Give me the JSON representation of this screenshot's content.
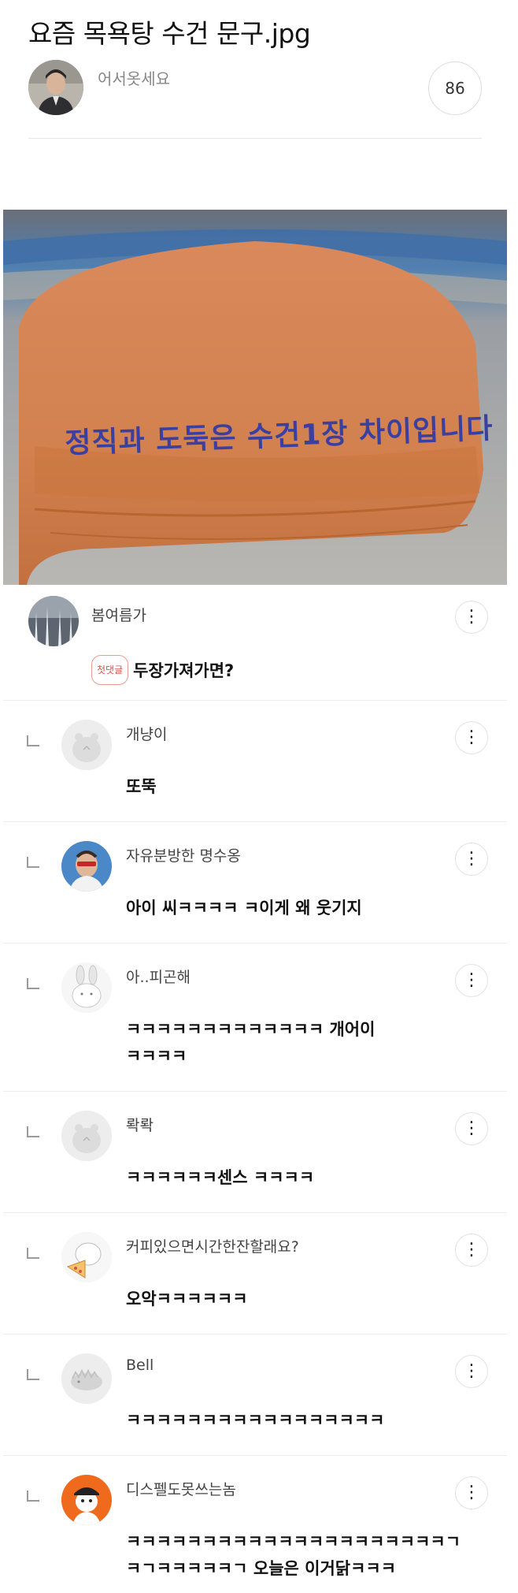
{
  "post": {
    "title": "요즘 목욕탕 수건 문구.jpg",
    "author": "어서옷세요",
    "comment_count": "86",
    "image_text": "정직과 도둑은 수건1장 차이입니다"
  },
  "icons": {
    "more": "more-vertical-icon",
    "reply": "reply-arrow-icon"
  },
  "comments": [
    {
      "name": "봄여름가",
      "badge": "첫댓글",
      "body": "두장가져가면?"
    },
    {
      "name": "개냥이",
      "body": "또뚝"
    },
    {
      "name": "자유분방한 명수옹",
      "body": "아이 씨ㅋㅋㅋㅋ ㅋ이게 왜 웃기지"
    },
    {
      "name": "아..피곤해",
      "body_line1": "ㅋㅋㅋㅋㅋㅋㅋㅋㅋㅋㅋㅋㅋ 개어이",
      "body_line2": "ㅋㅋㅋㅋ"
    },
    {
      "name": "롹롹",
      "body": "ㅋㅋㅋㅋㅋㅋ센스 ㅋㅋㅋㅋ"
    },
    {
      "name": "커피있으면시간한잔할래요?",
      "body": "오악ㅋㅋㅋㅋㅋㅋ"
    },
    {
      "name": "Bell",
      "body": "ㅋㅋㅋㅋㅋㅋㅋㅋㅋㅋㅋㅋㅋㅋㅋㅋㅋ"
    },
    {
      "name": "디스펠도못쓰는놈",
      "body_line1": "ㅋㅋㅋㅋㅋㅋㅋㅋㅋㅋㅋㅋㅋㅋㅋㅋㅋㅋㅋㅋㅋㄱ",
      "body_line2": "ㅋㄱㅋㅋㅋㅋㅋㄱ 오늘은 이거닭ㅋㅋㅋ"
    }
  ]
}
